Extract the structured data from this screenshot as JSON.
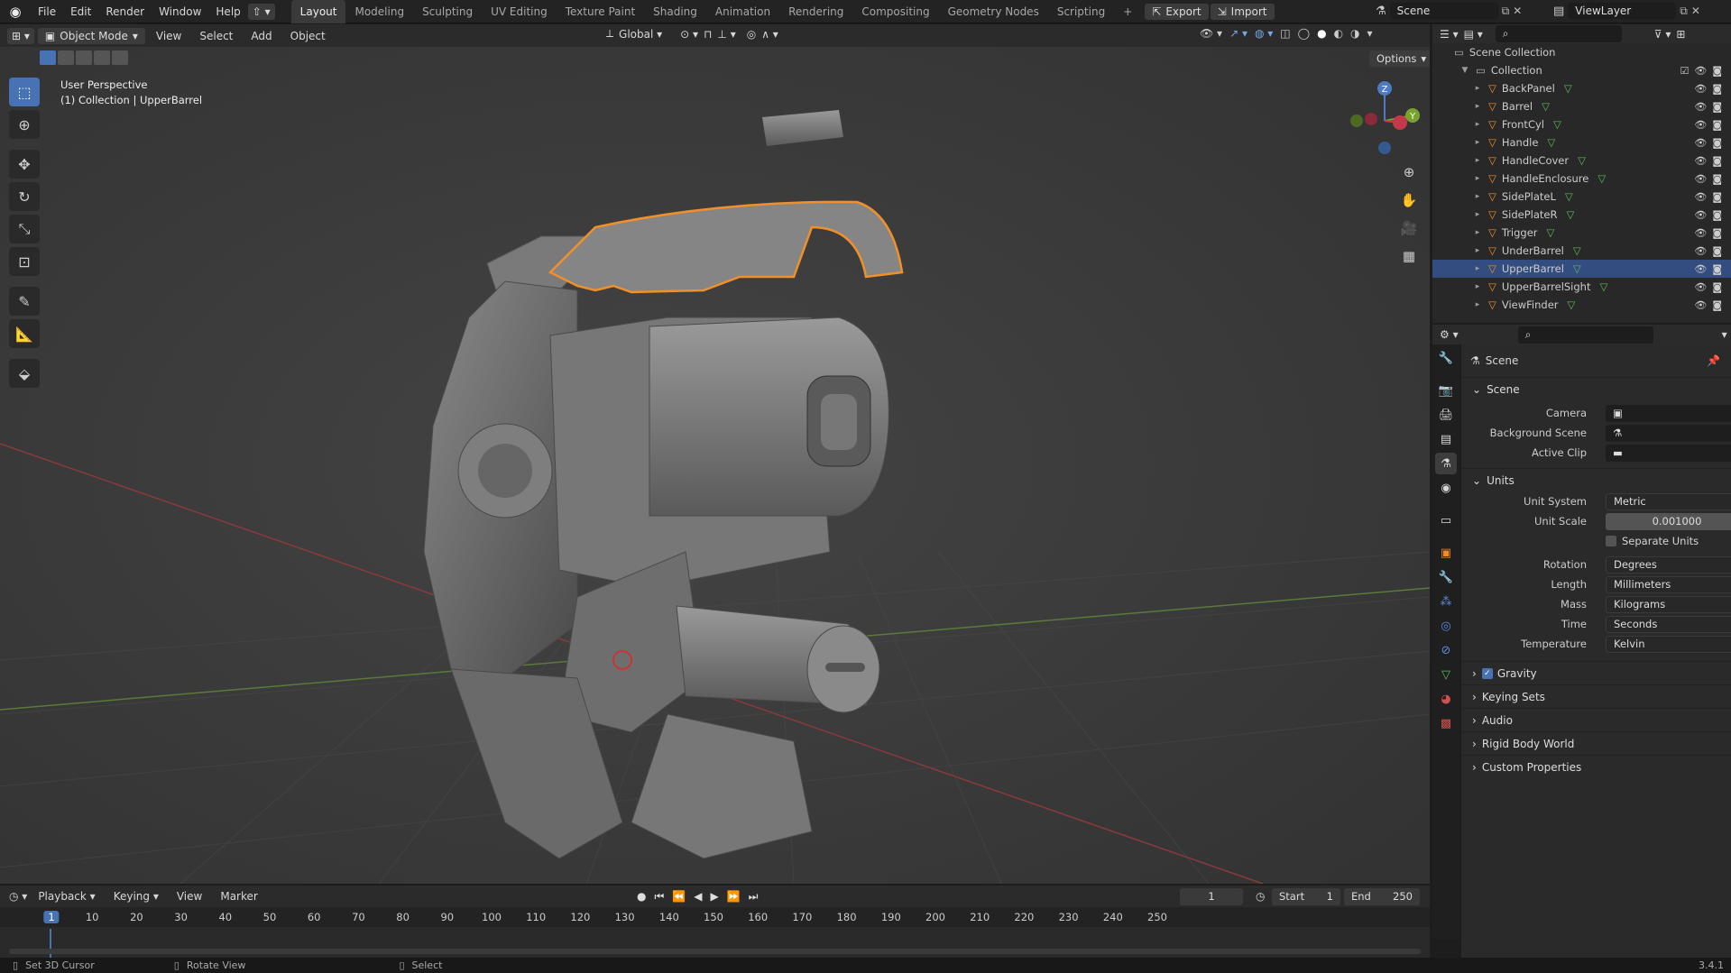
{
  "menu": [
    "File",
    "Edit",
    "Render",
    "Window",
    "Help"
  ],
  "workspaces": [
    "Layout",
    "Modeling",
    "Sculpting",
    "UV Editing",
    "Texture Paint",
    "Shading",
    "Animation",
    "Rendering",
    "Compositing",
    "Geometry Nodes",
    "Scripting"
  ],
  "topbar": {
    "export": "Export",
    "import": "Import",
    "scene": "Scene",
    "viewlayer": "ViewLayer"
  },
  "viewport_header": {
    "mode": "Object Mode",
    "view": "View",
    "select": "Select",
    "add": "Add",
    "object": "Object",
    "orientation": "Global",
    "options": "Options"
  },
  "viewport": {
    "perspective": "User Perspective",
    "context": "(1) Collection | UpperBarrel"
  },
  "gizmo": {
    "z": "Z",
    "y": "Y"
  },
  "outliner": {
    "root": "Scene Collection",
    "collection": "Collection",
    "items": [
      "BackPanel",
      "Barrel",
      "FrontCyl",
      "Handle",
      "HandleCover",
      "HandleEnclosure",
      "SidePlateL",
      "SidePlateR",
      "Trigger",
      "UnderBarrel",
      "UpperBarrel",
      "UpperBarrelSight",
      "ViewFinder"
    ],
    "selected": "UpperBarrel"
  },
  "properties": {
    "title": "Scene",
    "scene_section": "Scene",
    "camera_label": "Camera",
    "background_label": "Background Scene",
    "clip_label": "Active Clip",
    "units_section": "Units",
    "unit_system_label": "Unit System",
    "unit_system": "Metric",
    "unit_scale_label": "Unit Scale",
    "unit_scale": "0.001000",
    "separate_units": "Separate Units",
    "rotation_label": "Rotation",
    "rotation": "Degrees",
    "length_label": "Length",
    "length": "Millimeters",
    "mass_label": "Mass",
    "mass": "Kilograms",
    "time_label": "Time",
    "time": "Seconds",
    "temperature_label": "Temperature",
    "temperature": "Kelvin",
    "gravity": "Gravity",
    "keying_sets": "Keying Sets",
    "audio": "Audio",
    "rigid_body": "Rigid Body World",
    "custom_props": "Custom Properties"
  },
  "timeline": {
    "playback": "Playback",
    "keying": "Keying",
    "view": "View",
    "marker": "Marker",
    "current": "1",
    "start_label": "Start",
    "start": "1",
    "end_label": "End",
    "end": "250",
    "ticks": [
      "1",
      "10",
      "20",
      "30",
      "40",
      "50",
      "60",
      "70",
      "80",
      "90",
      "100",
      "110",
      "120",
      "130",
      "140",
      "150",
      "160",
      "170",
      "180",
      "190",
      "200",
      "210",
      "220",
      "230",
      "240",
      "250"
    ]
  },
  "status": {
    "cursor": "Set 3D Cursor",
    "rotate": "Rotate View",
    "select": "Select",
    "version": "3.4.1"
  },
  "colors": {
    "selected": "#334d80",
    "outline": "#f0902a",
    "accent": "#4772b3"
  }
}
